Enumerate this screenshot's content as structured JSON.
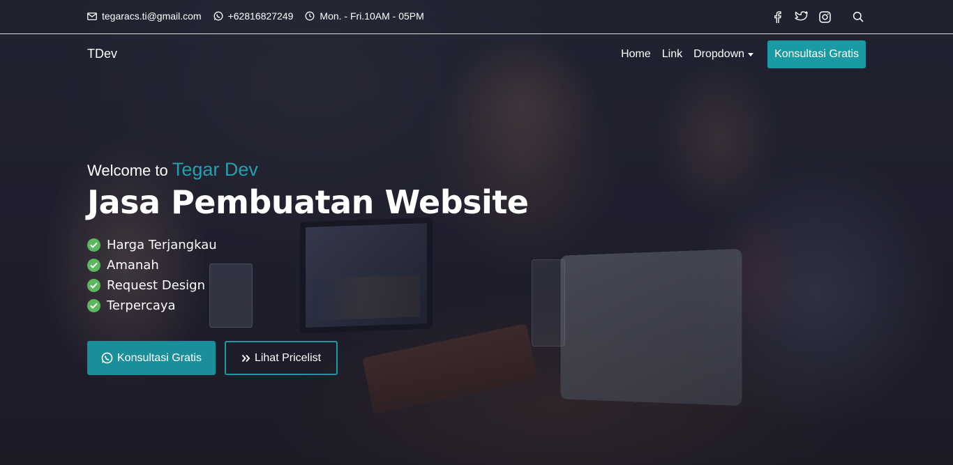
{
  "topbar": {
    "email": "tegaracs.ti@gmail.com",
    "phone": "+62816827249",
    "hours": "Mon. - Fri.10AM - 05PM",
    "icons": [
      "mail-icon",
      "whatsapp-icon",
      "clock-icon",
      "facebook-icon",
      "twitter-icon",
      "instagram-icon",
      "search-icon"
    ]
  },
  "navbar": {
    "brand": "TDev",
    "links": [
      "Home",
      "Link",
      "Dropdown"
    ],
    "cta": "Konsultasi Gratis"
  },
  "hero": {
    "welcome_prefix": "Welcome to",
    "welcome_accent": "Tegar Dev",
    "headline": "Jasa Pembuatan Website",
    "features": [
      "Harga Terjangkau",
      "Amanah",
      "Request Design",
      "Terpercaya"
    ],
    "primary_button": "Konsultasi Gratis",
    "secondary_button": "Lihat Pricelist"
  },
  "colors": {
    "accent": "#1a9aa2",
    "check": "#5cb85c"
  }
}
